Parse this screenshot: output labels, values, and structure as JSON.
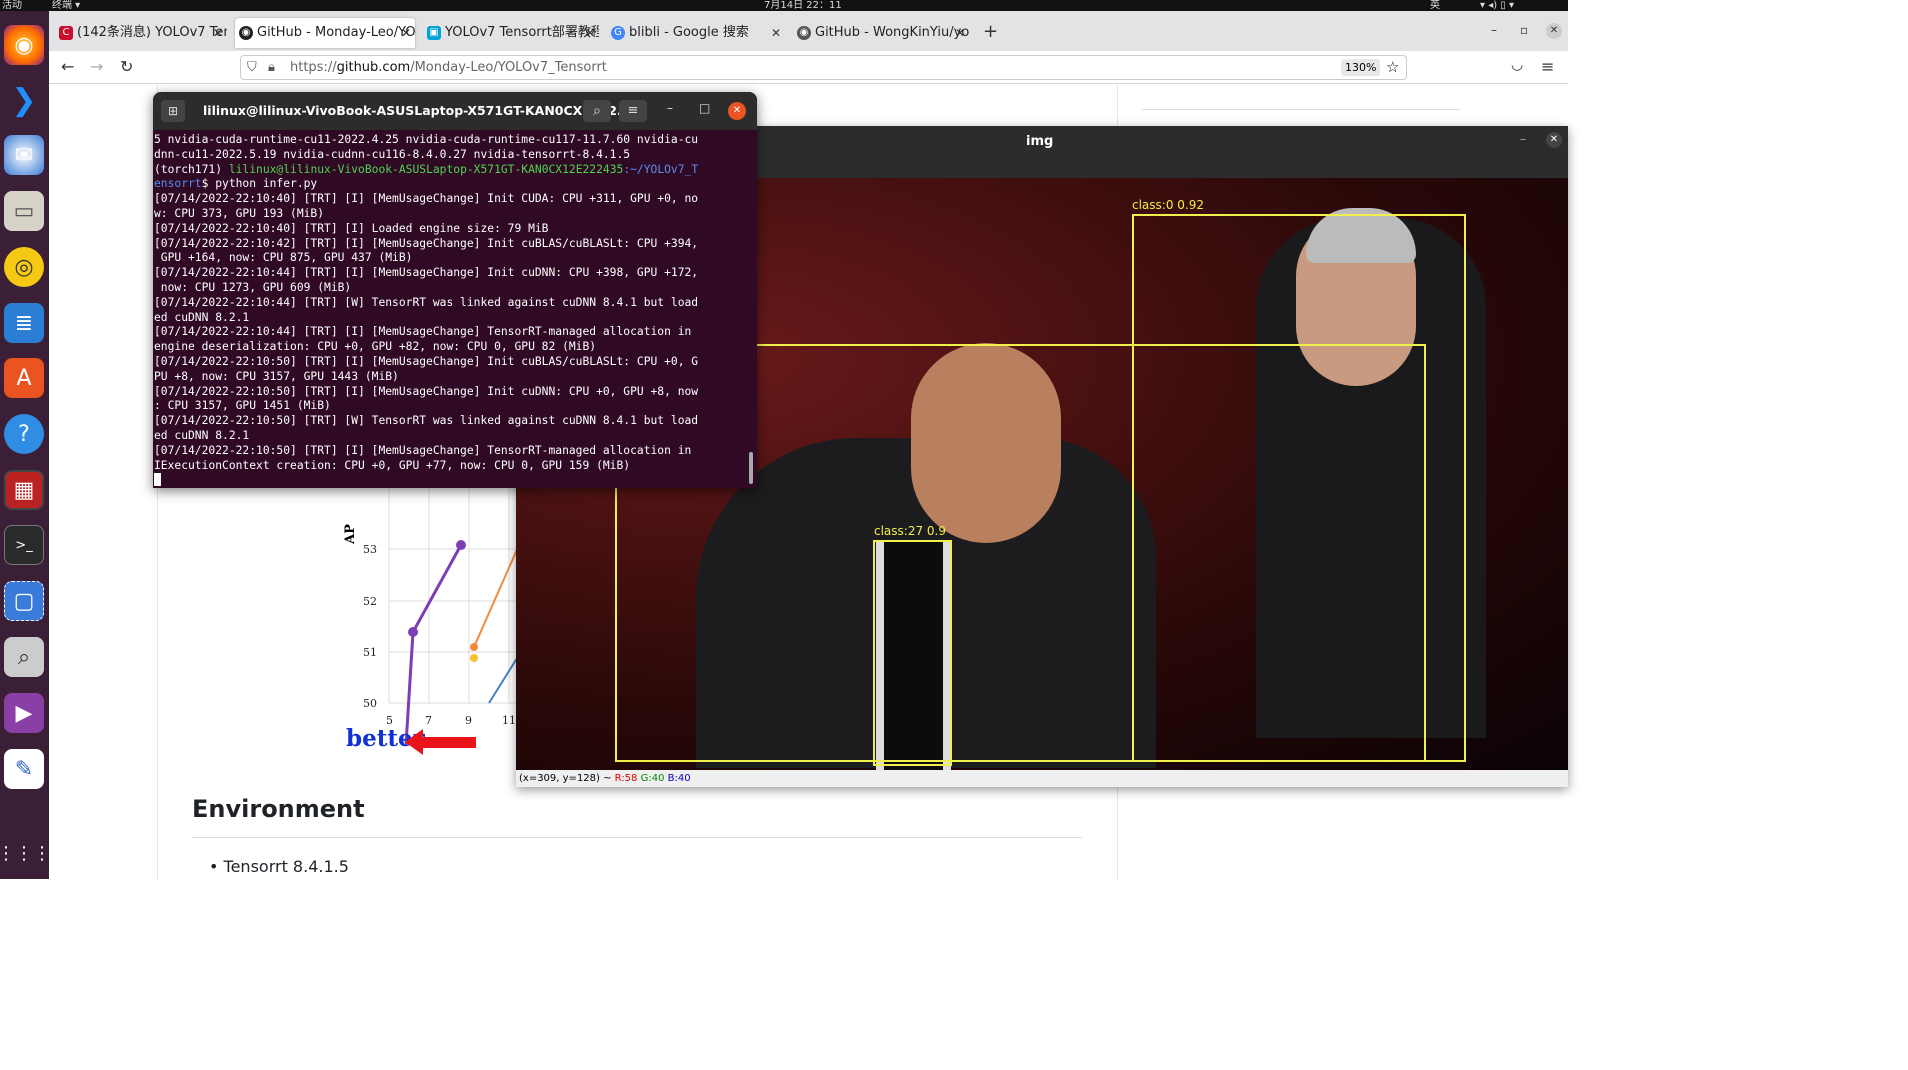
{
  "topbar": {
    "activities": "活动",
    "app": "终端",
    "clock": "7月14日 22：11",
    "ime": "英"
  },
  "dock": {
    "icons": [
      "firefox-icon",
      "vscode-icon",
      "thunderbird-icon",
      "files-icon",
      "rhythmbox-icon",
      "writer-icon",
      "app-center-icon",
      "help-icon",
      "screen-icon",
      "terminal-icon",
      "screenshot-icon",
      "magnifier-icon",
      "video-icon",
      "text-editor-icon",
      "app-grid-icon"
    ]
  },
  "browser": {
    "tabs": [
      {
        "label": "(142条消息) YOLOv7 Ten",
        "icon": "C",
        "color": "#c8102e"
      },
      {
        "label": "GitHub - Monday-Leo/YO",
        "icon": "G",
        "color": "#222"
      },
      {
        "label": "YOLOv7 Tensorrt部署教程",
        "icon": "▣",
        "color": "#00a1d6"
      },
      {
        "label": "blibli - Google 搜索",
        "icon": "G",
        "color": "#4285f4"
      },
      {
        "label": "GitHub - WongKinYiu/yol",
        "icon": "G",
        "color": "#555"
      }
    ],
    "url": "https://github.com/Monday-Leo/YOLOv7_Tensorrt",
    "url_host": "github.com",
    "url_pre": "https://",
    "url_path": "/Monday-Leo/YOLOv7_Tensorrt",
    "zoom": "130%"
  },
  "page": {
    "heading": "Environment",
    "bullet": "Tensorrt 8.4.1.5",
    "better": "better",
    "chart": {
      "ylabel": "AP",
      "yticks": [
        "53",
        "52",
        "51",
        "50"
      ],
      "xticks": [
        "5",
        "7",
        "9",
        "11"
      ]
    }
  },
  "terminal": {
    "title": "lilinux@lilinux-VivoBook-ASUSLaptop-X571GT-KAN0CX12E2...",
    "prompt_env": "(torch171) ",
    "prompt_user": "lilinux@lilinux-VivoBook-ASUSLaptop-X571GT-KAN0CX12E222435",
    "prompt_path": ":~/YOLOv7_T\nensorrt",
    "command": "$ python infer.py",
    "pre_lines": "5 nvidia-cuda-runtime-cu11-2022.4.25 nvidia-cuda-runtime-cu117-11.7.60 nvidia-cu\ndnn-cu11-2022.5.19 nvidia-cudnn-cu116-8.4.0.27 nvidia-tensorrt-8.4.1.5\n",
    "output": "[07/14/2022-22:10:40] [TRT] [I] [MemUsageChange] Init CUDA: CPU +311, GPU +0, no\nw: CPU 373, GPU 193 (MiB)\n[07/14/2022-22:10:40] [TRT] [I] Loaded engine size: 79 MiB\n[07/14/2022-22:10:42] [TRT] [I] [MemUsageChange] Init cuBLAS/cuBLASLt: CPU +394,\n GPU +164, now: CPU 875, GPU 437 (MiB)\n[07/14/2022-22:10:44] [TRT] [I] [MemUsageChange] Init cuDNN: CPU +398, GPU +172,\n now: CPU 1273, GPU 609 (MiB)\n[07/14/2022-22:10:44] [TRT] [W] TensorRT was linked against cuDNN 8.4.1 but load\ned cuDNN 8.2.1\n[07/14/2022-22:10:44] [TRT] [I] [MemUsageChange] TensorRT-managed allocation in\nengine deserialization: CPU +0, GPU +82, now: CPU 0, GPU 82 (MiB)\n[07/14/2022-22:10:50] [TRT] [I] [MemUsageChange] Init cuBLAS/cuBLASLt: CPU +0, G\nPU +8, now: CPU 3157, GPU 1443 (MiB)\n[07/14/2022-22:10:50] [TRT] [I] [MemUsageChange] Init cuDNN: CPU +0, GPU +8, now\n: CPU 3157, GPU 1451 (MiB)\n[07/14/2022-22:10:50] [TRT] [W] TensorRT was linked against cuDNN 8.4.1 but load\ned cuDNN 8.2.1\n[07/14/2022-22:10:50] [TRT] [I] [MemUsageChange] TensorRT-managed allocation in\nIExecutionContext creation: CPU +0, GPU +77, now: CPU 0, GPU 159 (MiB)"
  },
  "imgwin": {
    "title": "img",
    "detections": [
      {
        "label": "class:0  0.92"
      },
      {
        "label": "class:27  0.9"
      }
    ],
    "status_pos": "(x=309, y=128) ~ ",
    "status_r": "R:58",
    "status_g": "G:40",
    "status_b": "B:40"
  }
}
